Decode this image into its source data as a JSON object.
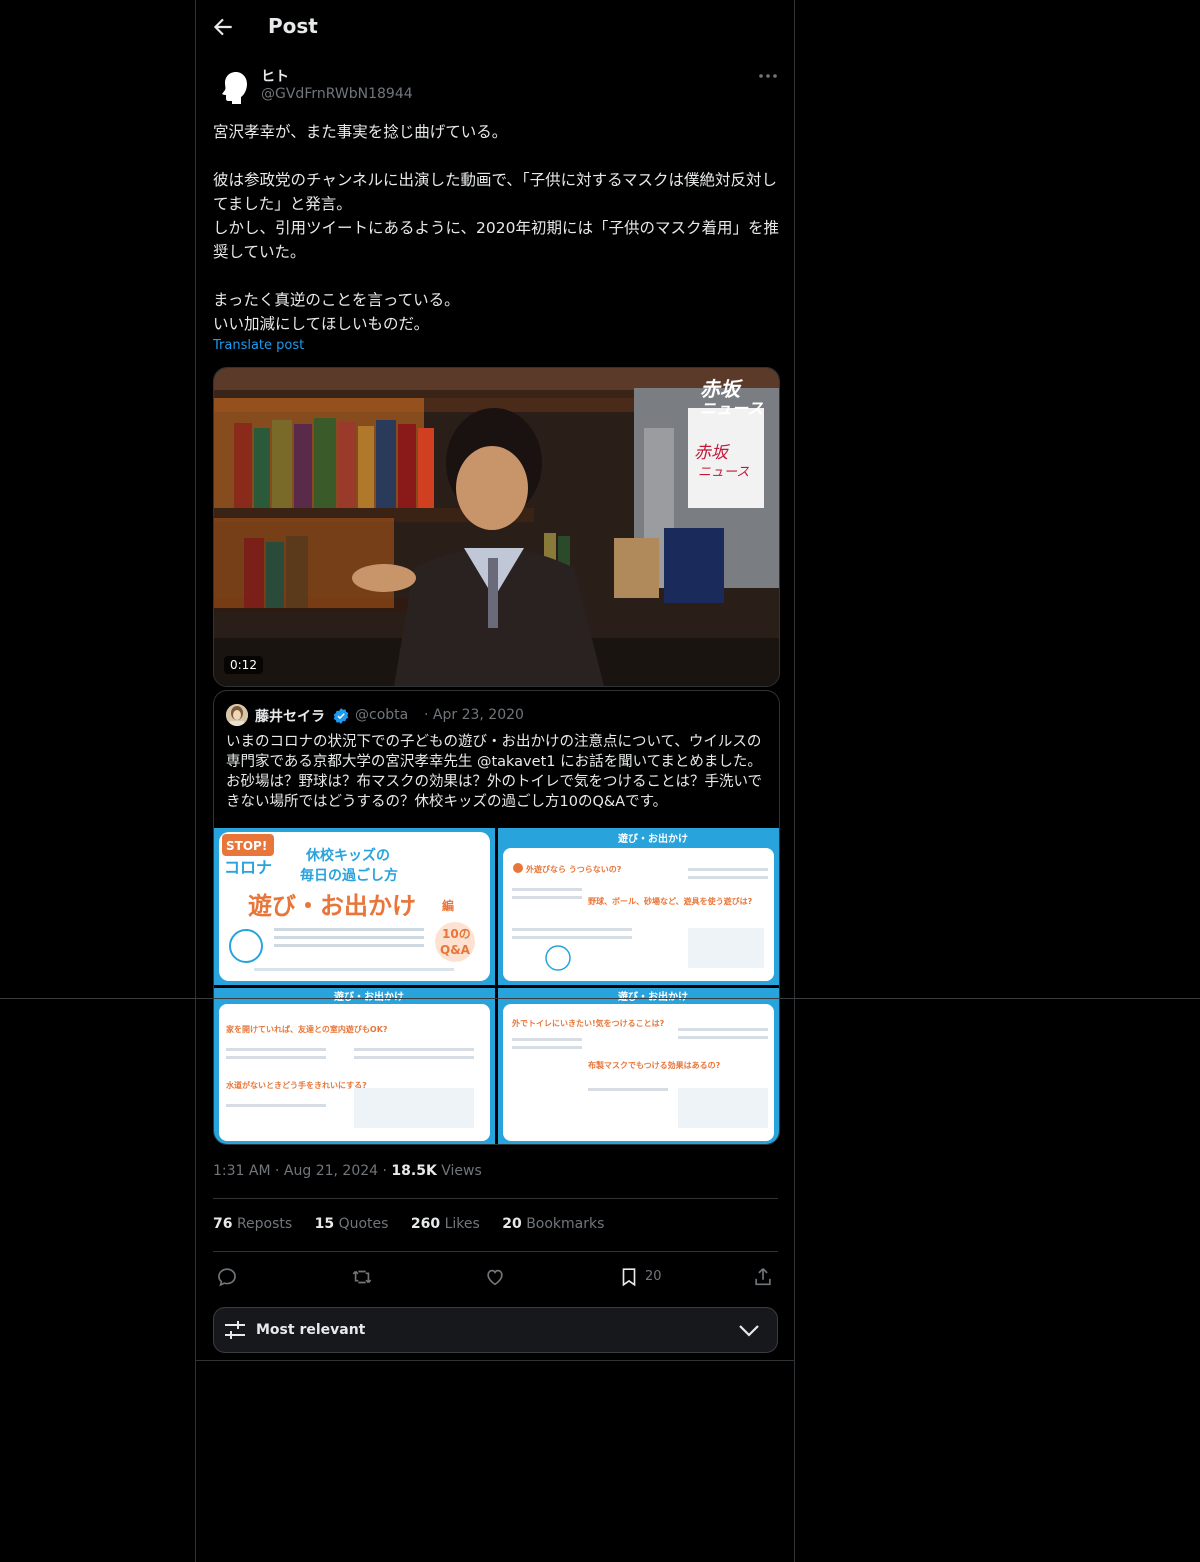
{
  "topbar": {
    "title": "Post"
  },
  "author": {
    "name": "ヒト",
    "handle": "@GVdFrnRWbN18944"
  },
  "post": {
    "text": "宮沢孝幸が、また事実を捻じ曲げている。\n\n彼は参政党のチャンネルに出演した動画で、「子供に対するマスクは僕絶対反対してました」と発言。\nしかし、引用ツイートにあるように、2020年初期には「子供のマスク着用」を推奨していた。\n\nまったく真逆のことを言っている。\nいい加減にしてほしいものだ。",
    "translate_label": "Translate post"
  },
  "video": {
    "duration": "0:12",
    "sign_text_1": "赤坂",
    "sign_text_2": "ニュース"
  },
  "quote": {
    "name": "藤井セイラ",
    "handle": "@cobta",
    "date": "Apr 23, 2020",
    "text": "いまのコロナの状況下での子どもの遊び・お出かけの注意点について、ウイルスの専門家である京都大学の宮沢孝幸先生 @takavet1 にお話を聞いてまとめました。お砂場は？野球は？布マスクの効果は？外のトイレで気をつけることは？手洗いできない場所ではどうするの？休校キッズの過ごし方10のQ&Aです。",
    "img1": {
      "stop": "STOP!",
      "corona": "コロナ",
      "title1": "休校キッズの",
      "title2": "毎日の過ごし方",
      "headline": "遊び・お出かけ",
      "hen": "編",
      "qa1": "10の",
      "qa2": "Q&A"
    },
    "panel_header": "遊び・お出かけ",
    "img2": {
      "q1": "外遊びなら うつらないの?",
      "q3": "野球、ボール、砂場など、遊具を使う遊びは?"
    },
    "img3": {
      "q4": "家を開けていれば、友達との室内遊びもOK?",
      "q5": "水道がないときどう手をきれいにする?"
    },
    "img4": {
      "q8": "外でトイレにいきたい!気をつけることは?",
      "q9": "布製マスクでもつける効果はあるの?"
    }
  },
  "meta": {
    "time": "1:31 AM",
    "date": "Aug 21, 2024",
    "views_count": "18.5K",
    "views_label": "Views"
  },
  "stats": {
    "reposts_count": "76",
    "reposts_label": "Reposts",
    "quotes_count": "15",
    "quotes_label": "Quotes",
    "likes_count": "260",
    "likes_label": "Likes",
    "bookmarks_count": "20",
    "bookmarks_label": "Bookmarks"
  },
  "actions": {
    "bookmark_count": "20"
  },
  "sort": {
    "label": "Most relevant"
  },
  "colors": {
    "accent": "#1d9bf0",
    "background": "#000000",
    "border": "#2f3336",
    "muted": "#71767b",
    "panel_blue": "#29a3dc",
    "panel_orange": "#e8763a"
  }
}
